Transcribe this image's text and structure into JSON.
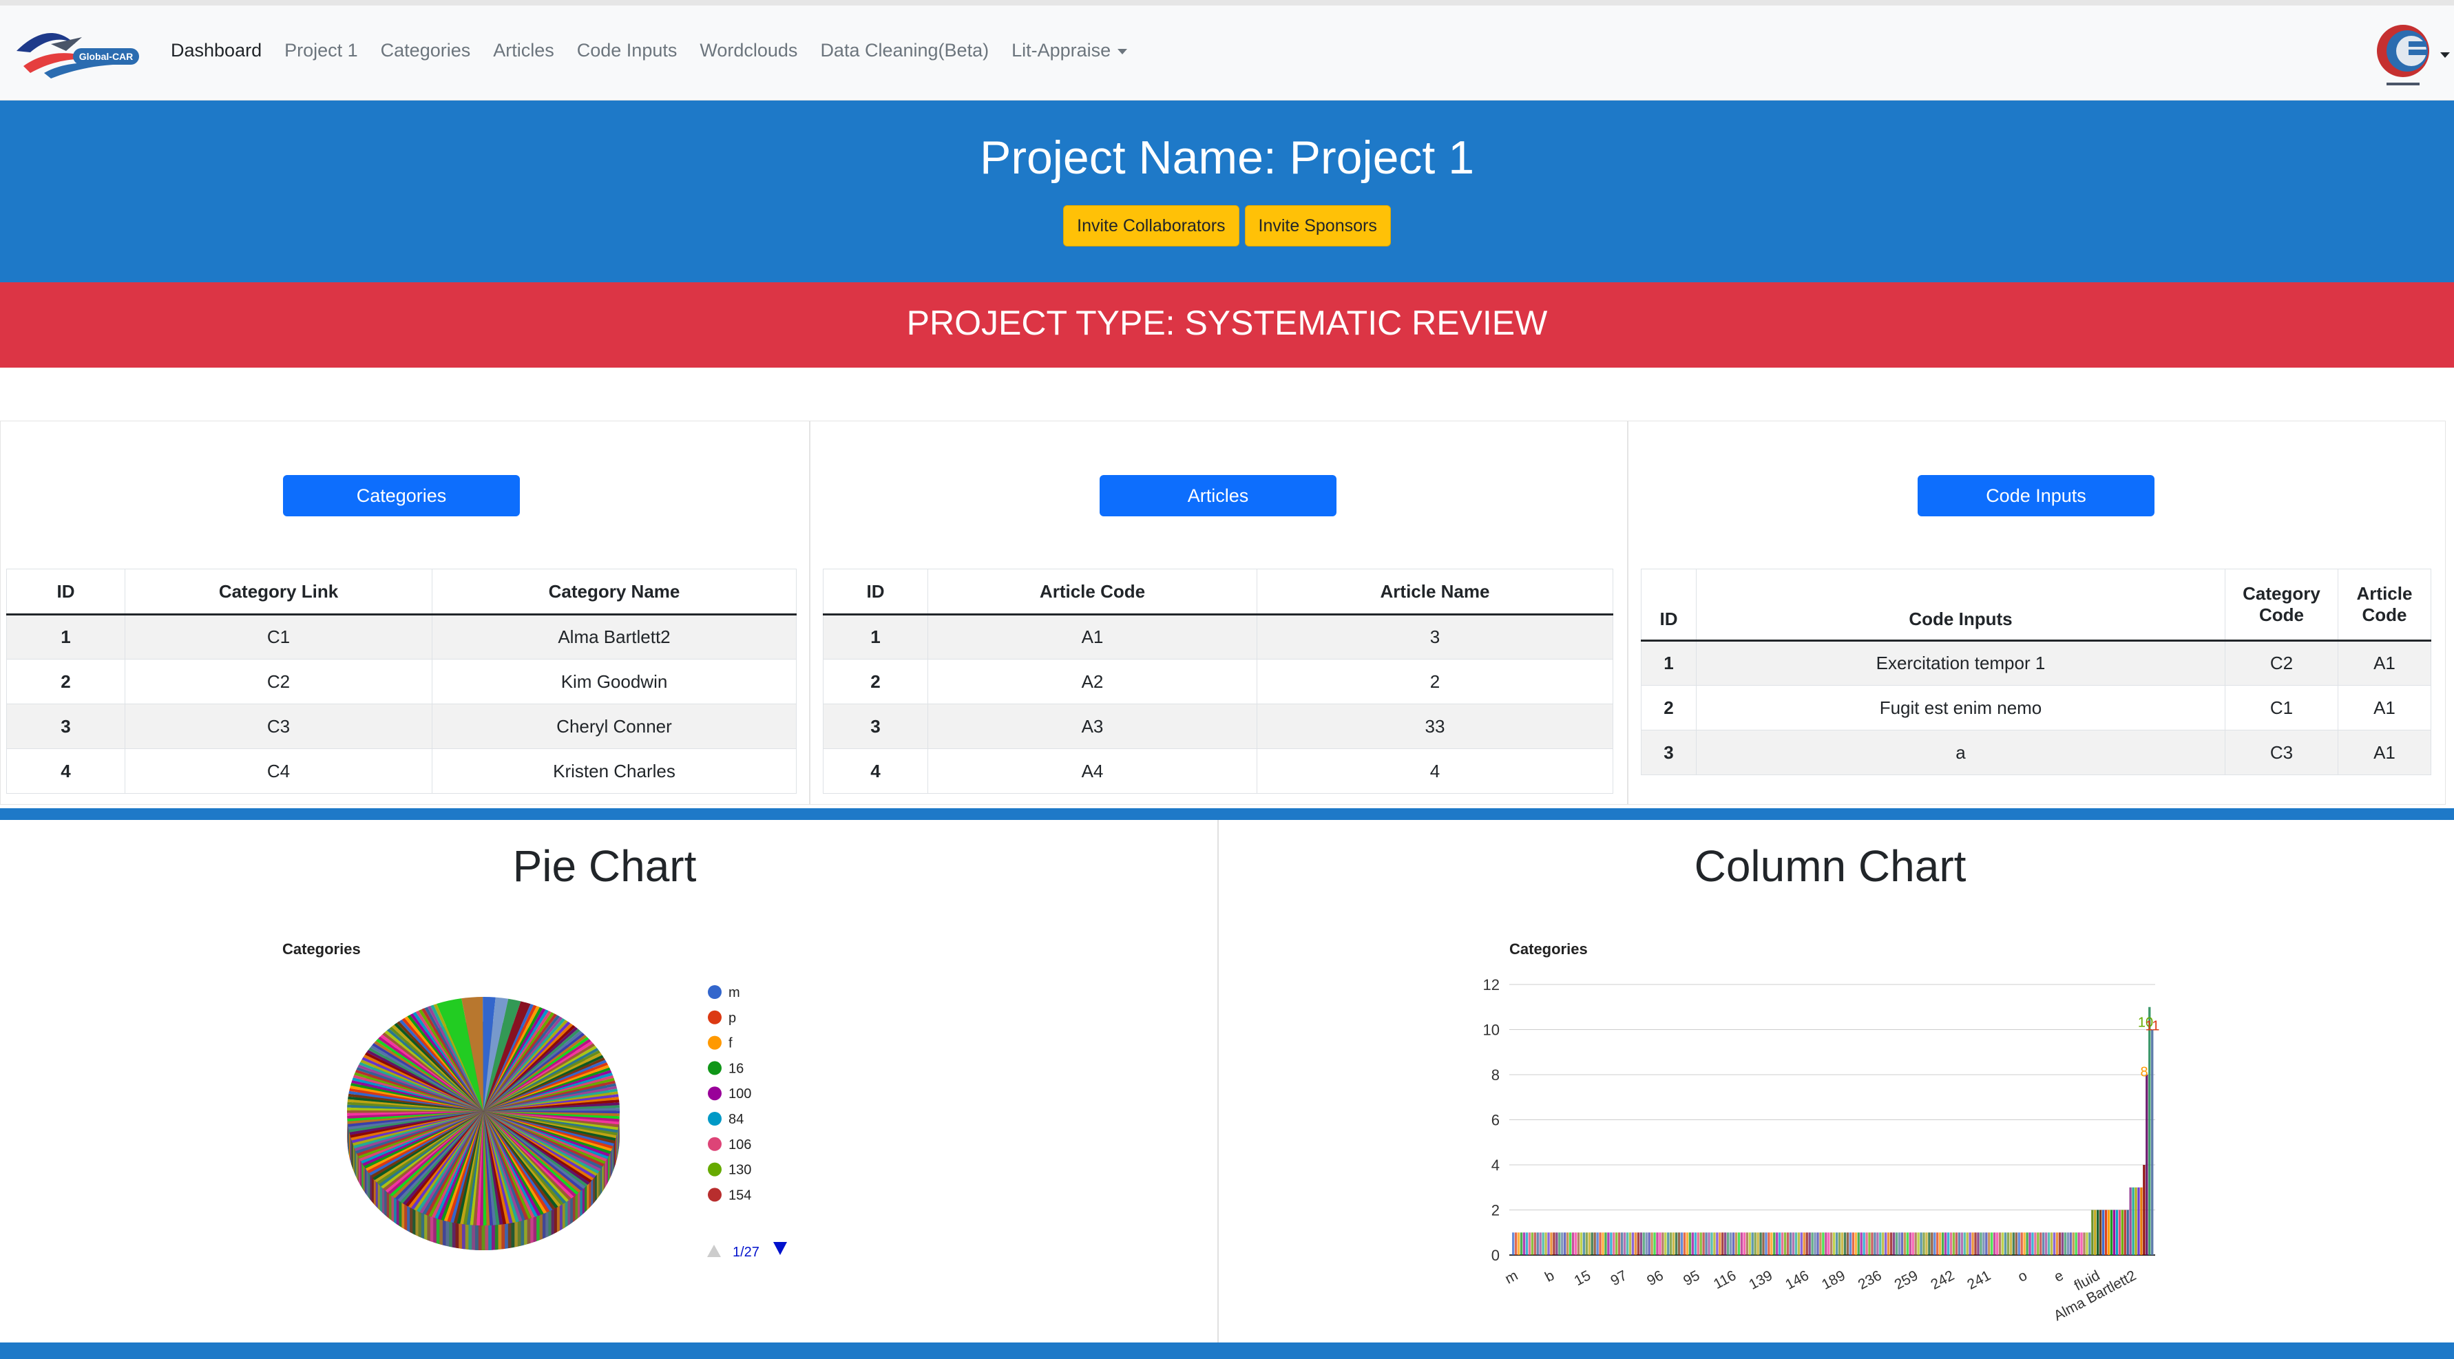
{
  "nav": {
    "logo_text": "Global-CAR",
    "items": [
      {
        "label": "Dashboard",
        "active": true
      },
      {
        "label": "Project 1"
      },
      {
        "label": "Categories"
      },
      {
        "label": "Articles"
      },
      {
        "label": "Code Inputs"
      },
      {
        "label": "Wordclouds"
      },
      {
        "label": "Data Cleaning(Beta)"
      }
    ],
    "dropdown": {
      "label": "Lit-Appraise"
    }
  },
  "header": {
    "project_title": "Project Name: Project 1",
    "invite_collaborators": "Invite Collaborators",
    "invite_sponsors": "Invite Sponsors",
    "project_type": "PROJECT TYPE: SYSTEMATIC REVIEW"
  },
  "categories_panel": {
    "button": "Categories",
    "headers": [
      "ID",
      "Category Link",
      "Category Name"
    ],
    "rows": [
      [
        "1",
        "C1",
        "Alma Bartlett2"
      ],
      [
        "2",
        "C2",
        "Kim Goodwin"
      ],
      [
        "3",
        "C3",
        "Cheryl Conner"
      ],
      [
        "4",
        "C4",
        "Kristen Charles"
      ]
    ]
  },
  "articles_panel": {
    "button": "Articles",
    "headers": [
      "ID",
      "Article Code",
      "Article Name"
    ],
    "rows": [
      [
        "1",
        "A1",
        "3"
      ],
      [
        "2",
        "A2",
        "2"
      ],
      [
        "3",
        "A3",
        "33"
      ],
      [
        "4",
        "A4",
        "4"
      ]
    ]
  },
  "codes_panel": {
    "button": "Code Inputs",
    "headers": [
      "ID",
      "Code Inputs",
      "Category Code",
      "Article Code"
    ],
    "rows": [
      [
        "1",
        "Exercitation tempor 1",
        "C2",
        "A1"
      ],
      [
        "2",
        "Fugit est enim nemo",
        "C1",
        "A1"
      ],
      [
        "3",
        "a",
        "C3",
        "A1"
      ]
    ]
  },
  "charts": {
    "pie_heading": "Pie Chart",
    "column_heading": "Column Chart"
  },
  "chart_data": [
    {
      "type": "pie",
      "title": "Categories",
      "legend": {
        "placement": "right",
        "entries": [
          {
            "label": "m",
            "color": "#3366cc"
          },
          {
            "label": "p",
            "color": "#dc3912"
          },
          {
            "label": "f",
            "color": "#ff9900"
          },
          {
            "label": "16",
            "color": "#109618"
          },
          {
            "label": "100",
            "color": "#990099"
          },
          {
            "label": "84",
            "color": "#0099c6"
          },
          {
            "label": "106",
            "color": "#dd4477"
          },
          {
            "label": "130",
            "color": "#66aa00"
          },
          {
            "label": "154",
            "color": "#b82e2e"
          }
        ],
        "page": "1/27"
      },
      "highlighted_slices": [
        {
          "fraction": 0.03,
          "color": "#22cc22"
        },
        {
          "fraction": 0.025,
          "color": "#b8772e"
        },
        {
          "fraction": 0.015,
          "color": "#3366cc"
        },
        {
          "fraction": 0.015,
          "color": "#7799cc"
        },
        {
          "fraction": 0.015,
          "color": "#339955"
        },
        {
          "fraction": 0.012,
          "color": "#881122"
        }
      ],
      "slice_count": 236
    },
    {
      "type": "bar",
      "title": "Categories",
      "categories": [
        "m",
        "b",
        "15",
        "97",
        "96",
        "95",
        "116",
        "139",
        "146",
        "189",
        "236",
        "259",
        "242",
        "241",
        "o",
        "e",
        "fluid",
        "Alma Bartlett2"
      ],
      "ylim": [
        0,
        12
      ],
      "yticks": [
        0,
        2,
        4,
        6,
        8,
        10,
        12
      ],
      "grid": true,
      "bars": {
        "count": 236,
        "baseline_value": 1,
        "tail_values": [
          2,
          2,
          2,
          2,
          2,
          2,
          2,
          2,
          2,
          2,
          2,
          2,
          2,
          2,
          3,
          3,
          3,
          3,
          3,
          4,
          8,
          11,
          10
        ]
      },
      "data_labels": [
        {
          "value": "10",
          "color": "#66aa00"
        },
        {
          "value": "11",
          "color": "#dc3912"
        },
        {
          "value": "8",
          "color": "#ff9900"
        }
      ]
    }
  ],
  "colors": {
    "primary_blue": "#1e79c8",
    "danger_red": "#dc3545",
    "warning_yellow": "#ffc107",
    "button_blue": "#0d6efd"
  }
}
